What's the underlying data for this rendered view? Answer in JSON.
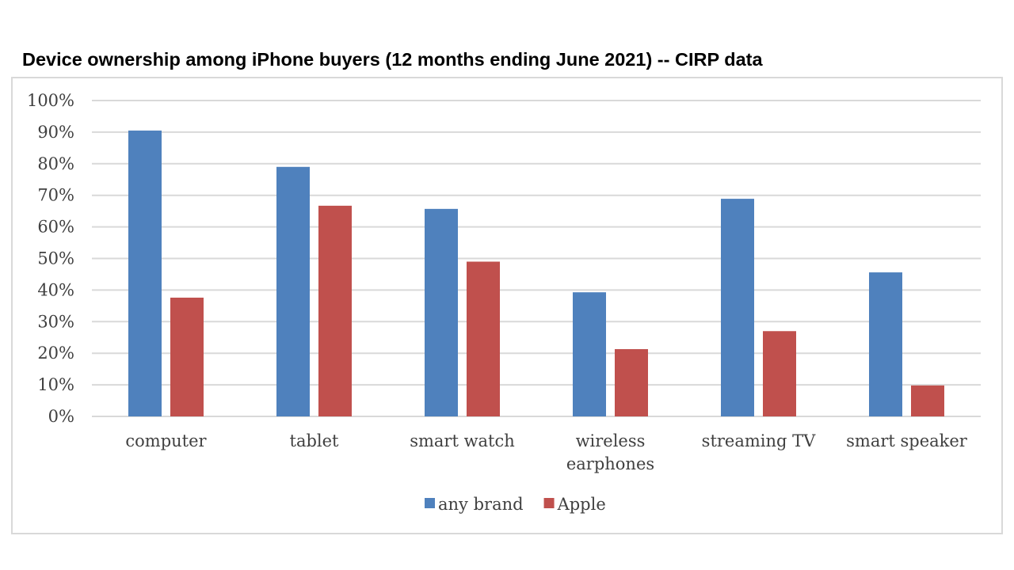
{
  "chart_data": {
    "type": "bar",
    "title": "Device ownership among iPhone buyers (12 months ending June 2021) -- CIRP data",
    "xlabel": "",
    "ylabel": "",
    "ylim": [
      0,
      100
    ],
    "yticks": [
      "0%",
      "10%",
      "20%",
      "30%",
      "40%",
      "50%",
      "60%",
      "70%",
      "80%",
      "90%",
      "100%"
    ],
    "grid": true,
    "legend_position": "bottom",
    "categories": [
      [
        "computer"
      ],
      [
        "tablet"
      ],
      [
        "smart watch"
      ],
      [
        "wireless",
        "earphones"
      ],
      [
        "streaming TV"
      ],
      [
        "smart speaker"
      ]
    ],
    "series": [
      {
        "name": "any brand",
        "color": "#4f81bd",
        "values": [
          90.5,
          79,
          65.7,
          39.3,
          68.9,
          45.6
        ]
      },
      {
        "name": "Apple",
        "color": "#c0504d",
        "values": [
          37.6,
          66.7,
          49,
          21.3,
          27,
          9.8
        ]
      }
    ]
  }
}
